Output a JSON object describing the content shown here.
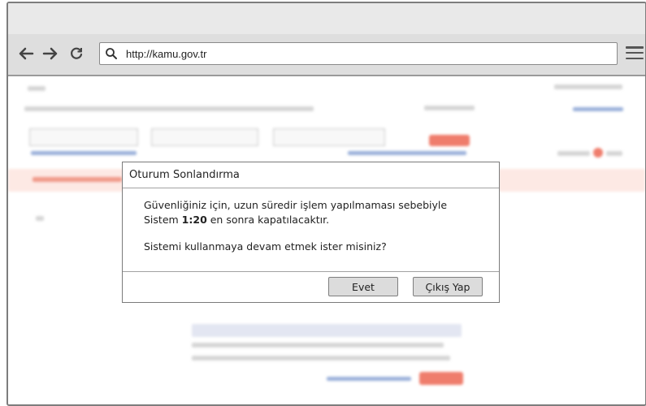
{
  "browser": {
    "url": "http://kamu.gov.tr"
  },
  "dialog": {
    "title": "Oturum Sonlandırma",
    "message_line1_pre": "Güvenliğiniz için, uzun süredir işlem yapılmaması sebebiyle",
    "message_line2_pre": "Sistem ",
    "countdown": "1:20",
    "message_line2_post": " en sonra kapatılacaktır.",
    "question": "Sistemi kullanmaya devam etmek ister misiniz?",
    "buttons": {
      "yes": "Evet",
      "logout": "Çıkış Yap"
    }
  },
  "colors": {
    "accent_red": "#ef7d6c",
    "link_blue": "#9ab0da"
  }
}
